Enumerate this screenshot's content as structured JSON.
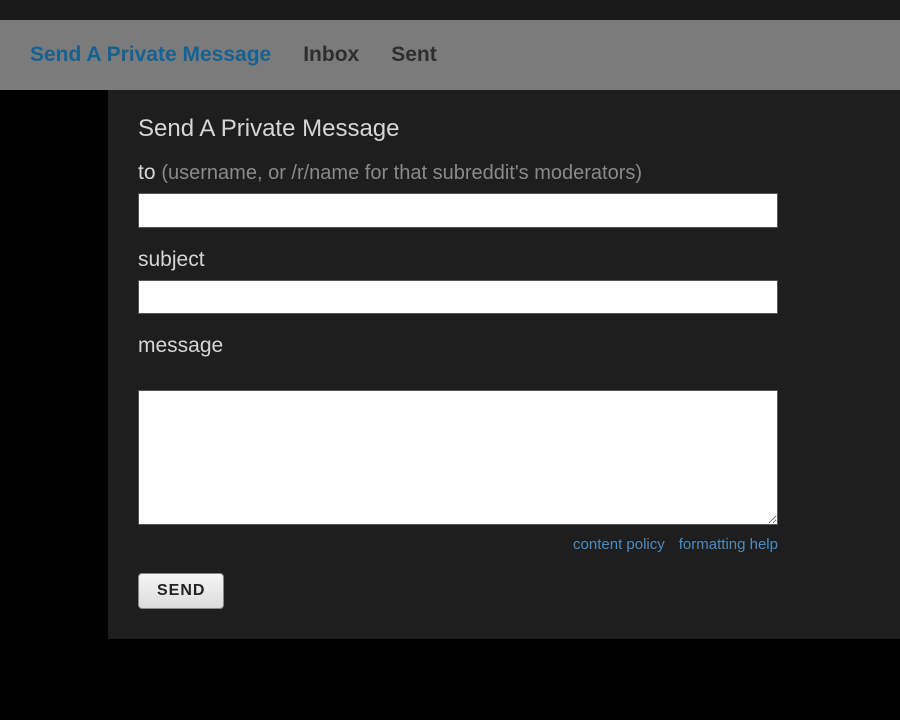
{
  "tabs": {
    "compose": "Send A Private Message",
    "inbox": "Inbox",
    "sent": "Sent"
  },
  "page": {
    "title": "Send A Private Message"
  },
  "form": {
    "to": {
      "label": "to",
      "hint": "(username, or /r/name for that subreddit's moderators)",
      "value": ""
    },
    "subject": {
      "label": "subject",
      "value": ""
    },
    "message": {
      "label": "message",
      "value": ""
    },
    "links": {
      "content_policy": "content policy",
      "formatting_help": "formatting help"
    },
    "send_button": "SEND"
  }
}
